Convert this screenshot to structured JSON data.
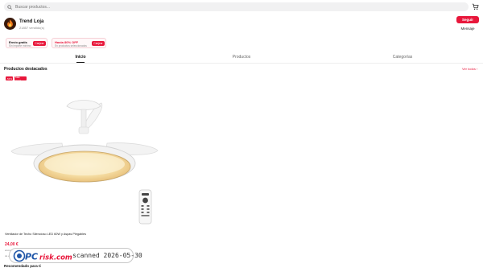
{
  "search": {
    "placeholder": "Buscar productos..."
  },
  "shop": {
    "name": "Trend Loja",
    "sold": "21857 vendido(s)",
    "follow_label": "Seguir",
    "message_label": "Mensaje"
  },
  "coupons": [
    {
      "title": "Envío gratis",
      "subtitle": "Sin importe mínimo",
      "button": "Canjear"
    },
    {
      "title": "Hasta 80% OFF",
      "subtitle": "En productos seleccionados",
      "button": "Canjear"
    }
  ],
  "tabs": [
    {
      "label": "Inicio",
      "active": true
    },
    {
      "label": "Productos",
      "active": false
    },
    {
      "label": "Categorías",
      "active": false
    }
  ],
  "featured": {
    "title": "Productos destacados",
    "see_all": "Ver todos ›",
    "badges": [
      "-54%",
      "Más vend."
    ],
    "product": {
      "title": "Ventilador de Techo Silencioso LED 60W y Aspas Plegables",
      "price": "24,00 €",
      "sub1": "anúncio",
      "sub2": "de envío"
    }
  },
  "recommended": {
    "title": "Recomendado para ti"
  },
  "watermark": {
    "logo_text": "PCrisk.com",
    "scan_text": "scanned 2026-05-30"
  },
  "colors": {
    "accent": "#e8173b",
    "search_bg": "#f1f1f2",
    "logo_bg": "#3a1a0c"
  }
}
